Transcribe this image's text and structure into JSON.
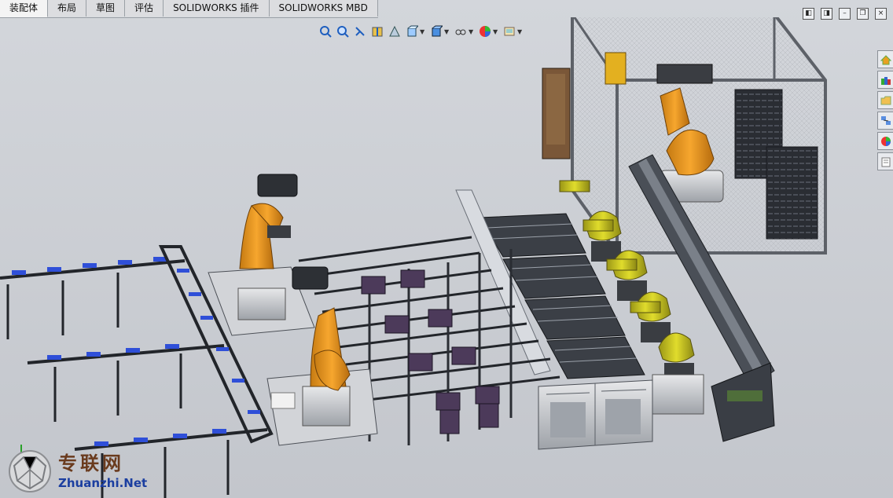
{
  "tabs": [
    {
      "label": "装配体",
      "active": true
    },
    {
      "label": "布局"
    },
    {
      "label": "草图"
    },
    {
      "label": "评估"
    },
    {
      "label": "SOLIDWORKS 插件"
    },
    {
      "label": "SOLIDWORKS MBD"
    }
  ],
  "hud_tools": [
    {
      "icon": "zoom-to-fit-icon"
    },
    {
      "icon": "zoom-to-area-icon"
    },
    {
      "icon": "previous-view-icon"
    },
    {
      "icon": "section-view-icon"
    },
    {
      "icon": "dynamic-annotation-icon"
    },
    {
      "icon": "view-orientation-icon",
      "dropdown": true
    },
    {
      "icon": "display-style-icon",
      "dropdown": true
    },
    {
      "icon": "hide-show-items-icon",
      "dropdown": true
    },
    {
      "icon": "edit-appearance-icon",
      "dropdown": true
    },
    {
      "icon": "apply-scene-icon",
      "dropdown": true
    }
  ],
  "window_controls": [
    {
      "icon": "tile-left-icon",
      "glyph": "◧"
    },
    {
      "icon": "tile-right-icon",
      "glyph": "◨"
    },
    {
      "icon": "minimize-icon",
      "glyph": "–"
    },
    {
      "icon": "restore-icon",
      "glyph": "❐"
    },
    {
      "icon": "close-icon",
      "glyph": "×"
    }
  ],
  "task_pane": [
    {
      "icon": "solidworks-resources-icon"
    },
    {
      "icon": "design-library-icon"
    },
    {
      "icon": "file-explorer-icon"
    },
    {
      "icon": "view-palette-icon"
    },
    {
      "icon": "appearances-scenes-icon"
    },
    {
      "icon": "custom-properties-icon"
    }
  ],
  "colors": {
    "robot_orange": "#f0a32a",
    "robot_yellow": "#d8d323",
    "frame_dark": "#2b2f36",
    "roller_blue": "#2f4fd8",
    "viewport_bg": "#c9ccd2"
  },
  "watermark": {
    "cn": "专联网",
    "en": "Zhuanzhi.Net"
  }
}
